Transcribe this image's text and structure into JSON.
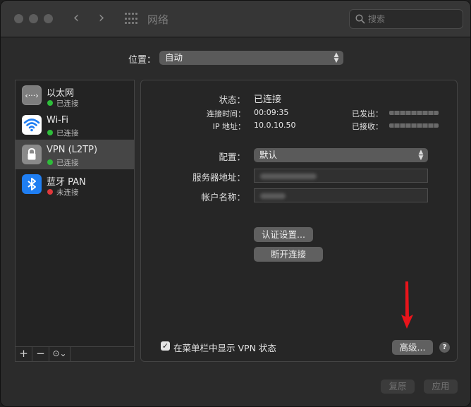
{
  "window": {
    "title": "网络",
    "search_placeholder": "搜索"
  },
  "location": {
    "label": "位置：",
    "value": "自动"
  },
  "services": [
    {
      "name": "以太网",
      "status": "已连接",
      "status_color": "#2ebd3a",
      "icon": "ethernet-icon"
    },
    {
      "name": "Wi-Fi",
      "status": "已连接",
      "status_color": "#2ebd3a",
      "icon": "wifi-icon"
    },
    {
      "name": "VPN (L2TP)",
      "status": "已连接",
      "status_color": "#2ebd3a",
      "icon": "lock-icon"
    },
    {
      "name": "蓝牙 PAN",
      "status": "未连接",
      "status_color": "#e0383b",
      "icon": "bluetooth-icon"
    }
  ],
  "sidebar_buttons": {
    "add": "+",
    "remove": "−",
    "action": "⊙⌄"
  },
  "detail": {
    "status_label": "状态：",
    "status_value": "已连接",
    "connect_time_label": "连接时间：",
    "connect_time_value": "00:09:35",
    "ip_label": "IP 地址：",
    "ip_value": "10.0.10.50",
    "sent_label": "已发出：",
    "received_label": "已接收：",
    "config_label": "配置：",
    "config_value": "默认",
    "server_label": "服务器地址：",
    "account_label": "帐户名称：",
    "auth_button": "认证设置...",
    "disconnect_button": "断开连接",
    "show_vpn_status_label": "在菜单栏中显示 VPN 状态",
    "show_vpn_status_checked": true,
    "advanced_button": "高级...",
    "help_button": "?"
  },
  "footer": {
    "revert_button": "复原",
    "apply_button": "应用"
  },
  "colors": {
    "window_bg": "#2b2b2b",
    "annotation_arrow": "#e8141b",
    "wifi_icon_bg": "#ffffff",
    "bluetooth_icon_bg": "#1f7ef2"
  }
}
